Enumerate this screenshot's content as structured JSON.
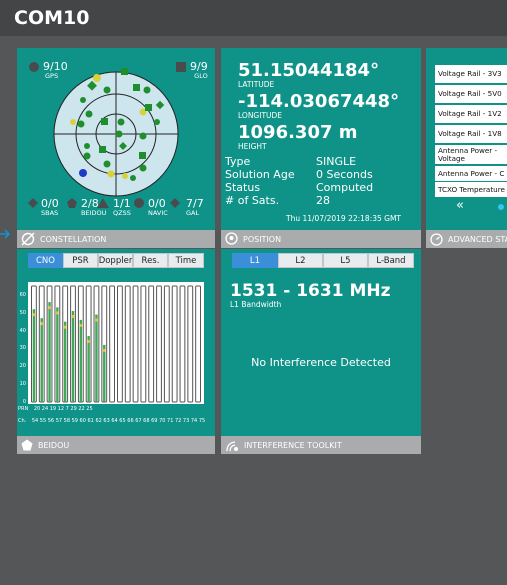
{
  "app": {
    "title": "COM10"
  },
  "constellation": {
    "footer_label": "CONSTELLATION",
    "systems": [
      {
        "id": "gps",
        "count": "9/10",
        "name": "GPS",
        "shape": "circle"
      },
      {
        "id": "glo",
        "count": "9/9",
        "name": "GLO",
        "shape": "square"
      },
      {
        "id": "sbas",
        "count": "0/0",
        "name": "SBAS",
        "shape": "diamond"
      },
      {
        "id": "beidou",
        "count": "2/8",
        "name": "BEIDOU",
        "shape": "pentagon"
      },
      {
        "id": "qzss",
        "count": "1/1",
        "name": "QZSS",
        "shape": "triangle"
      },
      {
        "id": "navic",
        "count": "0/0",
        "name": "NAVIC",
        "shape": "circle"
      },
      {
        "id": "gal",
        "count": "7/7",
        "name": "GAL",
        "shape": "diamond"
      }
    ],
    "colors": {
      "panel": "#0f9389",
      "plot_bg": "#cde6ee",
      "green": "#1f8f2e",
      "yellow": "#d8d23a",
      "blue": "#1f3bc4"
    }
  },
  "position": {
    "footer_label": "POSITION",
    "latitude": "51.15044184°",
    "latitude_label": "LATITUDE",
    "longitude": "-114.03067448°",
    "longitude_label": "LONGITUDE",
    "height": "1096.307 m",
    "height_label": "HEIGHT",
    "fields": [
      {
        "key": "Type",
        "value": "SINGLE"
      },
      {
        "key": "Solution Age",
        "value": "0 Seconds"
      },
      {
        "key": "Status",
        "value": "Computed"
      },
      {
        "key": "# of Sats.",
        "value": "28"
      }
    ],
    "timestamp": "Thu 11/07/2019 22:18:35 GMT"
  },
  "advanced_status": {
    "footer_label": "ADVANCED STA",
    "rows": [
      "Voltage Rail - 3V3",
      "Voltage Rail - 5V0",
      "Voltage Rail - 1V2",
      "Voltage Rail - 1V8",
      "Antenna Power - Voltage",
      "Antenna Power - C",
      "TCXO Temperature"
    ],
    "nav_prev": "«"
  },
  "beidou": {
    "footer_label": "BEIDOU",
    "tabs": [
      "CNO",
      "PSR",
      "Doppler",
      "Res.",
      "Time"
    ],
    "selected_tab": "CNO",
    "prn_label": "PRN",
    "ch_label": "Ch.",
    "prn_values": "20 24 19 12 7 29 22 25",
    "ch_values": "54 55 56 57 58 59 60 61 62 63 64 65 66 67 68 69 70 71 72 73 74 75"
  },
  "interference": {
    "footer_label": "INTERFERENCE TOOLKIT",
    "tabs": [
      "L1",
      "L2",
      "L5",
      "L-Band"
    ],
    "selected_tab": "L1",
    "band_range": "1531 - 1631 MHz",
    "band_label": "L1 Bandwidth",
    "message": "No Interference Detected"
  },
  "chart_data": {
    "type": "bar",
    "categories": [
      "54",
      "55",
      "56",
      "57",
      "58",
      "59",
      "60",
      "61",
      "62",
      "63",
      "64",
      "65",
      "66",
      "67",
      "68",
      "69",
      "70",
      "71",
      "72",
      "73",
      "74",
      "75"
    ],
    "series": [
      {
        "values": [
          52,
          47,
          56,
          53,
          45,
          51,
          46,
          37,
          49,
          32,
          0,
          0,
          0,
          0,
          0,
          0,
          0,
          0,
          0,
          0,
          0,
          0
        ]
      }
    ],
    "y_ticks": [
      0,
      10,
      20,
      30,
      40,
      50,
      60
    ],
    "ylim": [
      0,
      65
    ],
    "colors": {
      "bar": "#3fa95a",
      "highlight": "#e6c23a"
    }
  }
}
